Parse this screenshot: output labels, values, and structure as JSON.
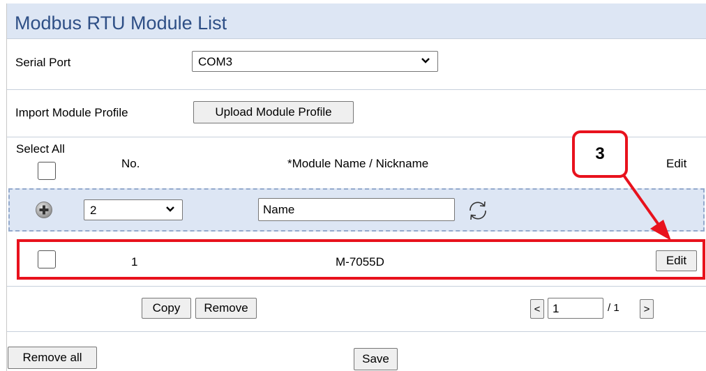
{
  "title": "Modbus RTU Module List",
  "serial_port": {
    "label": "Serial Port",
    "value": "COM3"
  },
  "import": {
    "label": "Import Module Profile",
    "button": "Upload Module Profile"
  },
  "table_header": {
    "select_all": "Select All",
    "no": "No.",
    "module_name": "*Module Name / Nickname",
    "edit": "Edit"
  },
  "add_row": {
    "count_value": "2",
    "name_value": "Name"
  },
  "rows": [
    {
      "no": "1",
      "module": "M-7055D",
      "edit_button": "Edit"
    }
  ],
  "actions": {
    "copy": "Copy",
    "remove": "Remove"
  },
  "pagination": {
    "prev": "<",
    "page": "1",
    "total": "/ 1",
    "next": ">"
  },
  "footer": {
    "remove_all": "Remove all",
    "save": "Save"
  },
  "callout": {
    "number": "3"
  },
  "colors": {
    "accent": "#e8121d",
    "header_bg": "#dde6f4",
    "title": "#2e4f86"
  }
}
